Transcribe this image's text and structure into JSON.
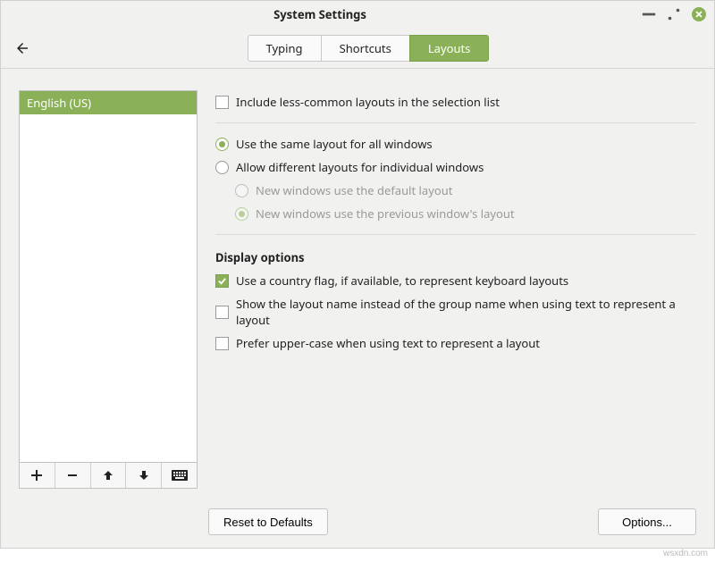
{
  "window": {
    "title": "System Settings"
  },
  "tabs": [
    {
      "label": "Typing",
      "active": false
    },
    {
      "label": "Shortcuts",
      "active": false
    },
    {
      "label": "Layouts",
      "active": true
    }
  ],
  "layout_list": {
    "items": [
      {
        "label": "English (US)",
        "selected": true
      }
    ]
  },
  "options": {
    "include_less_common": {
      "label": "Include less-common layouts in the selection list",
      "checked": false
    },
    "scope": {
      "same_for_all": {
        "label": "Use the same layout for all windows",
        "selected": true
      },
      "per_window": {
        "label": "Allow different layouts for individual windows",
        "selected": false
      },
      "new_default": {
        "label": "New windows use the default layout",
        "selected": false,
        "enabled": false
      },
      "new_previous": {
        "label": "New windows use the previous window's layout",
        "selected": true,
        "enabled": false
      }
    },
    "display_heading": "Display options",
    "display": {
      "country_flag": {
        "label": "Use a country flag, if available,  to represent keyboard layouts",
        "checked": true
      },
      "layout_name": {
        "label": "Show the layout name instead of the group name when using text to represent a layout",
        "checked": false
      },
      "uppercase": {
        "label": "Prefer upper-case when using text to represent a layout",
        "checked": false
      }
    }
  },
  "buttons": {
    "reset": "Reset to Defaults",
    "options": "Options..."
  },
  "watermark": "wsxdn.com"
}
